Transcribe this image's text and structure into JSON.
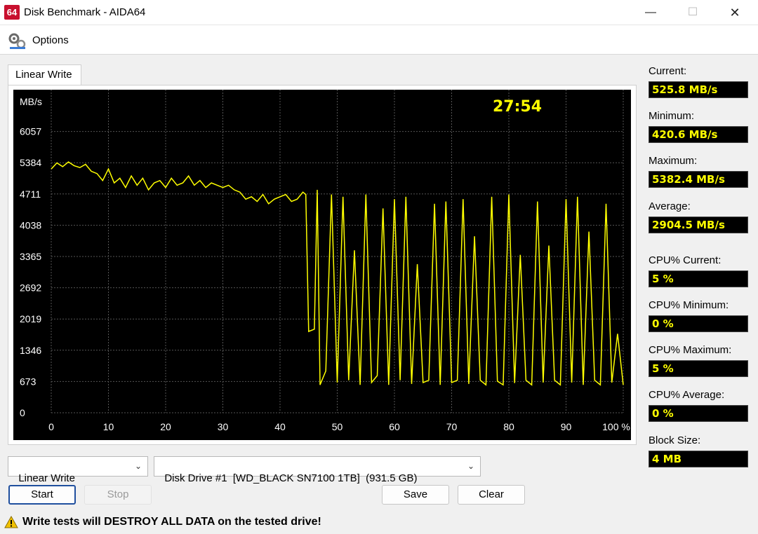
{
  "window": {
    "title": "Disk Benchmark - AIDA64",
    "logo": "64"
  },
  "menu": {
    "options_label": "Options"
  },
  "tab": {
    "label": "Linear Write"
  },
  "chart_data": {
    "type": "line",
    "timer": "27:54",
    "ylabel": "MB/s",
    "y_ticks": [
      "6057",
      "5384",
      "4711",
      "4038",
      "3365",
      "2692",
      "2019",
      "1346",
      "673",
      "0"
    ],
    "x_ticks": [
      "0",
      "10",
      "20",
      "30",
      "40",
      "50",
      "60",
      "70",
      "80",
      "90",
      "100 %"
    ],
    "ylim": [
      0,
      6730
    ],
    "xlim": [
      0,
      100
    ],
    "grid": true,
    "colors": {
      "line": "#ffff00",
      "background": "#000000",
      "grid": "#555555",
      "text": "#ffffff",
      "timer": "#ffff00"
    },
    "series": [
      {
        "x": [
          0,
          1,
          2,
          3,
          4,
          5,
          6,
          7,
          8,
          9,
          10,
          11,
          12,
          13,
          14,
          15,
          16,
          17,
          18,
          19,
          20,
          21,
          22,
          23,
          24,
          25,
          26,
          27,
          28,
          29,
          30,
          31,
          32,
          33,
          34,
          35,
          36,
          37,
          38,
          39,
          40,
          41,
          42,
          43,
          44,
          44.5,
          45,
          46,
          46.5,
          47,
          48,
          49,
          50,
          51,
          52,
          53,
          54,
          55,
          56,
          57,
          58,
          59,
          60,
          61,
          62,
          63,
          64,
          65,
          66,
          67,
          68,
          69,
          70,
          71,
          72,
          73,
          74,
          75,
          76,
          77,
          78,
          79,
          80,
          81,
          82,
          83,
          84,
          85,
          86,
          87,
          88,
          89,
          90,
          91,
          92,
          93,
          94,
          95,
          96,
          97,
          98,
          99,
          100
        ],
        "y": [
          5250,
          5380,
          5300,
          5400,
          5320,
          5280,
          5350,
          5200,
          5150,
          5000,
          5250,
          4950,
          5050,
          4850,
          5100,
          4900,
          5050,
          4800,
          4950,
          5000,
          4850,
          5050,
          4900,
          4950,
          5100,
          4900,
          5000,
          4850,
          4950,
          4900,
          4850,
          4900,
          4800,
          4750,
          4600,
          4650,
          4550,
          4700,
          4500,
          4600,
          4650,
          4700,
          4550,
          4600,
          4750,
          4700,
          1750,
          1800,
          4800,
          600,
          900,
          4700,
          650,
          4650,
          700,
          3500,
          600,
          4700,
          650,
          800,
          4400,
          600,
          4600,
          700,
          4650,
          620,
          3200,
          650,
          700,
          4500,
          600,
          4550,
          650,
          700,
          4600,
          620,
          3800,
          700,
          600,
          4650,
          680,
          600,
          4700,
          640,
          3400,
          700,
          600,
          4550,
          650,
          3600,
          700,
          600,
          4600,
          650,
          4650,
          600,
          3900,
          700,
          600,
          4500,
          650,
          1700,
          600
        ]
      }
    ]
  },
  "stats": {
    "current_label": "Current:",
    "current_value": "525.8 MB/s",
    "minimum_label": "Minimum:",
    "minimum_value": "420.6 MB/s",
    "maximum_label": "Maximum:",
    "maximum_value": "5382.4 MB/s",
    "average_label": "Average:",
    "average_value": "2904.5 MB/s",
    "cpu_current_label": "CPU% Current:",
    "cpu_current_value": "5 %",
    "cpu_minimum_label": "CPU% Minimum:",
    "cpu_minimum_value": "0 %",
    "cpu_maximum_label": "CPU% Maximum:",
    "cpu_maximum_value": "5 %",
    "cpu_average_label": "CPU% Average:",
    "cpu_average_value": "0 %",
    "block_size_label": "Block Size:",
    "block_size_value": "4 MB"
  },
  "controls": {
    "test_select": "Linear Write",
    "drive_select": "Disk Drive #1  [WD_BLACK SN7100 1TB]  (931.5 GB)",
    "start_label": "Start",
    "stop_label": "Stop",
    "save_label": "Save",
    "clear_label": "Clear"
  },
  "warning": {
    "text": "Write tests will DESTROY ALL DATA on the tested drive!"
  }
}
